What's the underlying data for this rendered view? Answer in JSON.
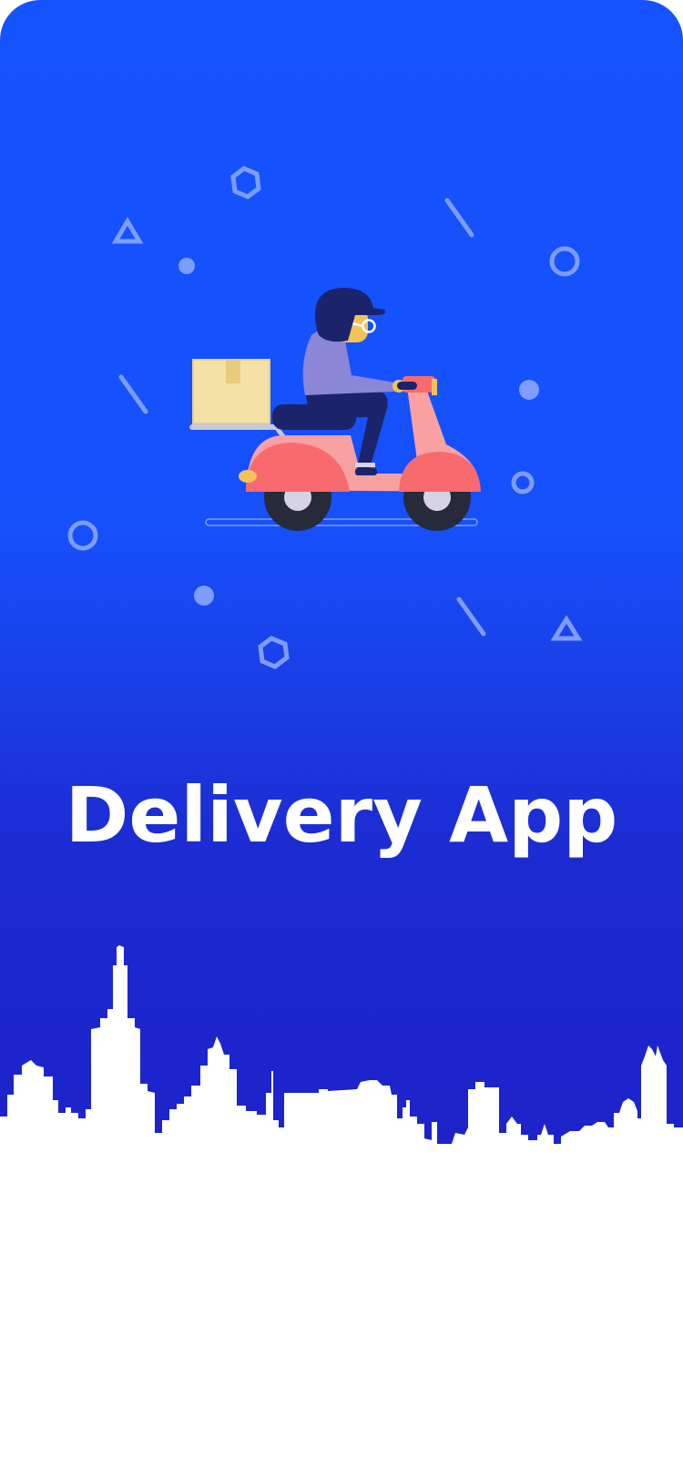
{
  "app": {
    "title": "Delivery App"
  },
  "illustration": {
    "subject": "delivery-person-on-scooter",
    "icons": [
      "box-icon",
      "scooter-icon",
      "courier-icon"
    ]
  },
  "decorations": [
    "hexagon-icon",
    "triangle-icon",
    "circle-icon",
    "dot-icon",
    "line-icon"
  ],
  "colors": {
    "hero_top": "#1553ff",
    "hero_bottom": "#1c22c8",
    "title": "#ffffff",
    "scooter": "#f76b6f",
    "scooter_light": "#f8a0a2",
    "helmet": "#1b236b",
    "jacket": "#8b86d6",
    "box": "#f3e1a6",
    "decoration": "#7f9cff"
  }
}
